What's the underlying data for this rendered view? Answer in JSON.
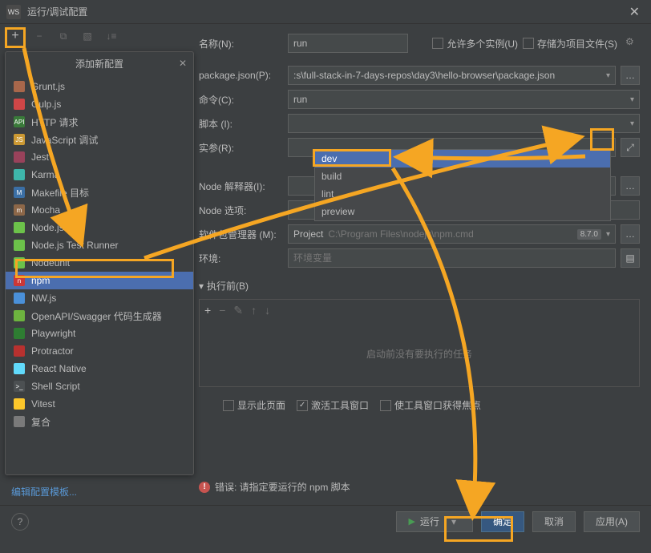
{
  "window": {
    "title": "运行/调试配置"
  },
  "toolbar": {
    "add_panel_title": "添加新配置"
  },
  "config_list": [
    {
      "id": "gruntjs",
      "label": "Grunt.js",
      "icon_bg": "#a8674b"
    },
    {
      "id": "gulpjs",
      "label": "Gulp.js",
      "icon_bg": "#cf4647"
    },
    {
      "id": "http",
      "label": "HTTP 请求",
      "icon_bg": "#3a7a3a",
      "icon_text": "API"
    },
    {
      "id": "js-debug",
      "label": "JavaScript 调试",
      "icon_bg": "#cc9933",
      "icon_text": "JS"
    },
    {
      "id": "jest",
      "label": "Jest",
      "icon_bg": "#99425b"
    },
    {
      "id": "karma",
      "label": "Karma",
      "icon_bg": "#3eb6ab"
    },
    {
      "id": "makefile",
      "label": "Makefile 目标",
      "icon_bg": "#3b6fa5",
      "icon_text": "M"
    },
    {
      "id": "mocha",
      "label": "Mocha",
      "icon_bg": "#8d6748",
      "icon_text": "m"
    },
    {
      "id": "nodejs",
      "label": "Node.js",
      "icon_bg": "#6cc24a"
    },
    {
      "id": "node-test",
      "label": "Node.js Test Runner",
      "icon_bg": "#6cc24a"
    },
    {
      "id": "nodeunit",
      "label": "Nodeunit",
      "icon_bg": "#6cc24a"
    },
    {
      "id": "npm",
      "label": "npm",
      "icon_bg": "#cb3837",
      "icon_text": "n",
      "selected": true
    },
    {
      "id": "nwjs",
      "label": "NW.js",
      "icon_bg": "#4a90d9"
    },
    {
      "id": "openapi",
      "label": "OpenAPI/Swagger 代码生成器",
      "icon_bg": "#6db33f"
    },
    {
      "id": "playwright",
      "label": "Playwright",
      "icon_bg": "#2e7d32"
    },
    {
      "id": "protractor",
      "label": "Protractor",
      "icon_bg": "#b8312f"
    },
    {
      "id": "react-native",
      "label": "React Native",
      "icon_bg": "#61dafb"
    },
    {
      "id": "shell",
      "label": "Shell Script",
      "icon_bg": "#4c5052",
      "icon_text": ">_"
    },
    {
      "id": "vitest",
      "label": "Vitest",
      "icon_bg": "#fcc72b"
    },
    {
      "id": "compound",
      "label": "复合",
      "icon_bg": "#7a7a7a"
    }
  ],
  "form": {
    "labels": {
      "name": "名称(N):",
      "package_json": "package.json(P):",
      "command": "命令(C):",
      "script": "脚本 (I):",
      "args": "实参(R):",
      "node_interpreter": "Node 解释器(I):",
      "node_options": "Node 选项:",
      "pkg_manager": "软件包管理器 (M):",
      "env": "环境:"
    },
    "name_value": "run",
    "allow_multiple": "允许多个实例(U)",
    "store_as_project": "存储为项目文件(S)",
    "package_json_value": ":s\\full-stack-in-7-days-repos\\day3\\hello-browser\\package.json",
    "command_value": "run",
    "script_value": "",
    "pkg_manager_prefix": "Project",
    "pkg_manager_path": "C:\\Program Files\\nodejs\\npm.cmd",
    "pkg_manager_version": "8.7.0",
    "env_placeholder": "环境变量"
  },
  "script_dropdown": [
    "dev",
    "build",
    "lint",
    "preview"
  ],
  "script_dropdown_selected": "dev",
  "before_launch": {
    "title": "执行前(B)",
    "empty_text": "启动前没有要执行的任务"
  },
  "options": {
    "show_page": "显示此页面",
    "activate_tool": "激活工具窗口",
    "focus_tool": "使工具窗口获得焦点"
  },
  "error_text": "错误: 请指定要运行的 npm 脚本",
  "edit_templates": "编辑配置模板...",
  "buttons": {
    "run": "运行",
    "ok": "确定",
    "cancel": "取消",
    "apply": "应用(A)"
  }
}
